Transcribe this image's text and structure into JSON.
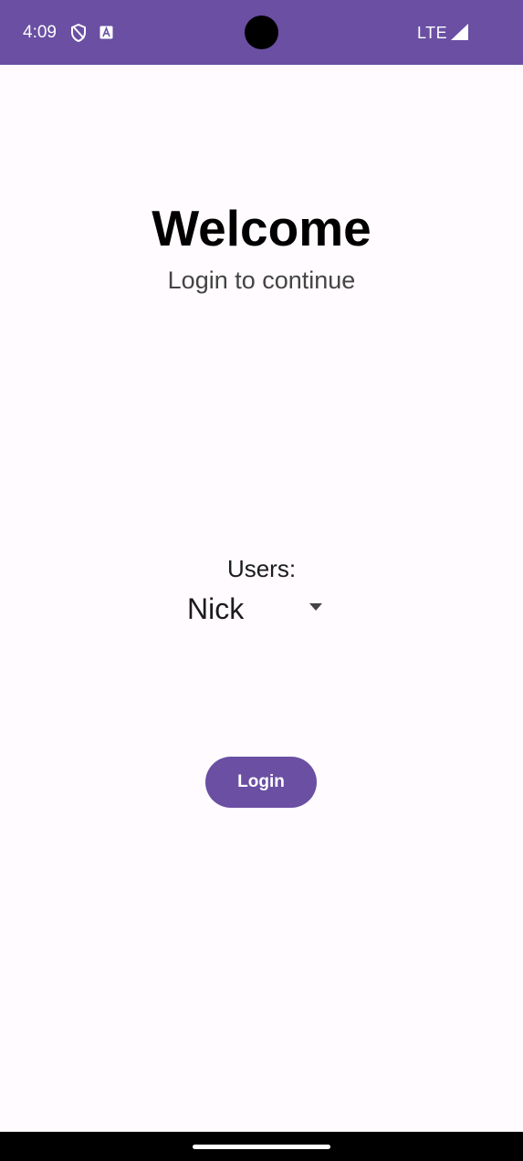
{
  "status_bar": {
    "time": "4:09",
    "network": "LTE",
    "icons": [
      "shield-icon",
      "a-box-icon",
      "signal-icon"
    ]
  },
  "header": {
    "title": "Welcome",
    "subtitle": "Login to continue"
  },
  "users": {
    "label": "Users:",
    "selected": "Nick"
  },
  "actions": {
    "login_label": "Login"
  },
  "colors": {
    "primary": "#6a4fa3",
    "background": "#fffbfe",
    "text": "#000000",
    "subtitle": "#444444"
  }
}
